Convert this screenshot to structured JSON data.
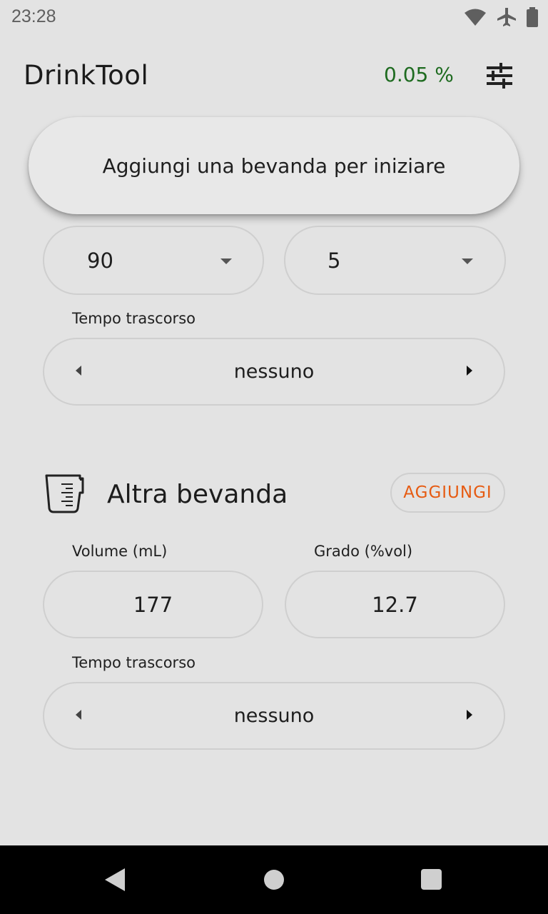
{
  "status_bar": {
    "time": "23:28",
    "icons": [
      "wifi-icon",
      "airplane-icon",
      "battery-icon"
    ]
  },
  "app": {
    "title": "DrinkTool",
    "bac_value": "0.05 %",
    "bac_color": "#1e6b20",
    "settings_icon": "tune-icon"
  },
  "banner": {
    "message": "Aggiungi una bevanda per iniziare"
  },
  "first_drink": {
    "volume_value": "90",
    "degree_value": "5",
    "time_label": "Tempo trascorso",
    "time_value": "nessuno"
  },
  "second_drink": {
    "title": "Altra bevanda",
    "icon": "measuring-cup-icon",
    "add_label": "AGGIUNGI",
    "add_color": "#e65b12",
    "volume_label": "Volume (mL)",
    "volume_value": "177",
    "degree_label": "Grado (%vol)",
    "degree_value": "12.7",
    "time_label": "Tempo trascorso",
    "time_value": "nessuno"
  },
  "nav": {
    "icons": [
      "back-icon",
      "home-icon",
      "recents-icon"
    ]
  }
}
